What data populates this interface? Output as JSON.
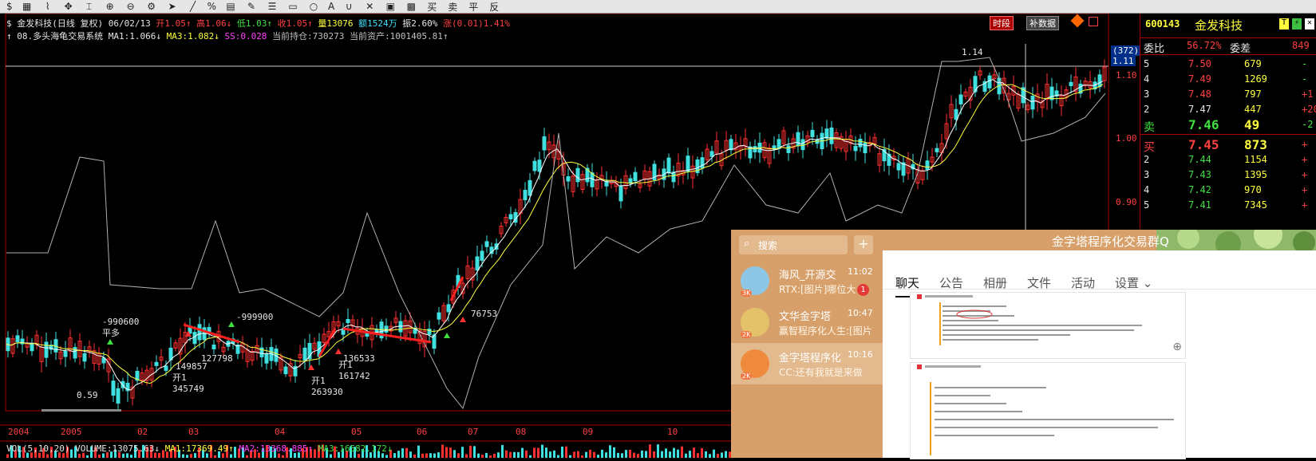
{
  "toolbar": {
    "items": [
      "$",
      "%",
      "A"
    ]
  },
  "chart_header": {
    "line1": [
      {
        "text": "$ 金发科技(日线 复权) 06/02/13",
        "color": "#e6e6e6"
      },
      {
        "text": "开1.05↑",
        "color": "#ff4040"
      },
      {
        "text": "高1.06↓",
        "color": "#ff4040"
      },
      {
        "text": "低1.03↑",
        "color": "#40e040"
      },
      {
        "text": "收1.05↑",
        "color": "#ff4040"
      },
      {
        "text": "量13076",
        "color": "#ffff40"
      },
      {
        "text": "额1524万",
        "color": "#40e0ff"
      },
      {
        "text": "振2.60%",
        "color": "#e6e6e6"
      },
      {
        "text": "涨(0.01)1.41%",
        "color": "#ff4040"
      }
    ],
    "line2": [
      {
        "text": "↑ 08.多头海龟交易系统 MA1:1.066↓",
        "color": "#e6e6e6"
      },
      {
        "text": "MA3:1.082↓",
        "color": "#ffff40"
      },
      {
        "text": "SS:0.028",
        "color": "#ff40ff"
      },
      {
        "text": "当前持仓:730273 当前资产:1001405.81↑",
        "color": "#c0c0c0"
      }
    ],
    "buttons": [
      "时段",
      "补数据"
    ]
  },
  "price_axis": {
    "labels": [
      "1.10",
      "1.00",
      "0.90"
    ],
    "badge_top": "(372)",
    "badge_price": "1.11"
  },
  "chart_annotations": [
    {
      "text": "1.14",
      "color": "#e6e6e6"
    },
    {
      "text": "0.59",
      "color": "#e6e6e6"
    },
    {
      "text": "-990600",
      "color": "#e6e6e6"
    },
    {
      "text": "平多",
      "color": "#e6e6e6"
    },
    {
      "text": "-999900",
      "color": "#e6e6e6"
    },
    {
      "text": "开1 345749",
      "color": "#e6e6e6"
    },
    {
      "text": "开1 263930",
      "color": "#e6e6e6"
    },
    {
      "text": "开1 161742",
      "color": "#e6e6e6"
    },
    {
      "text": "127798",
      "color": "#e6e6e6"
    },
    {
      "text": "149857",
      "color": "#e6e6e6"
    },
    {
      "text": "136533",
      "color": "#e6e6e6"
    },
    {
      "text": "76753",
      "color": "#e6e6e6"
    }
  ],
  "time_axis": {
    "labels": [
      "2004",
      "2005",
      "02",
      "03",
      "04",
      "05",
      "06",
      "07",
      "08",
      "09",
      "10"
    ]
  },
  "volume_line": [
    {
      "text": "VOL(5,10,20) VOLUME:13075.63↓",
      "color": "#e6e6e6"
    },
    {
      "text": "MA1:17369.49↑",
      "color": "#ffff40"
    },
    {
      "text": "MA2:13368.885↑",
      "color": "#ff40ff"
    },
    {
      "text": "MA3:16582.172↓",
      "color": "#40e040"
    }
  ],
  "quote": {
    "code": "600143",
    "name": "金发科技",
    "wei_bi_label": "委比",
    "wei_bi": "56.72%",
    "wei_cha_label": "委差",
    "wei_cha": "849",
    "sell": [
      {
        "level": "5",
        "price": "7.50",
        "vol": "679",
        "chg": "-"
      },
      {
        "level": "4",
        "price": "7.49",
        "vol": "1269",
        "chg": "-"
      },
      {
        "level": "3",
        "price": "7.48",
        "vol": "797",
        "chg": "+1"
      },
      {
        "level": "2",
        "price": "7.47",
        "vol": "447",
        "chg": "+20"
      },
      {
        "level": "卖",
        "price": "7.46",
        "vol": "49",
        "chg": "-2"
      }
    ],
    "buy": [
      {
        "level": "买",
        "price": "7.45",
        "vol": "873",
        "chg": "+"
      },
      {
        "level": "2",
        "price": "7.44",
        "vol": "1154",
        "chg": "+"
      },
      {
        "level": "3",
        "price": "7.43",
        "vol": "1395",
        "chg": "+"
      },
      {
        "level": "4",
        "price": "7.42",
        "vol": "970",
        "chg": "+"
      },
      {
        "level": "5",
        "price": "7.41",
        "vol": "7345",
        "chg": "+"
      }
    ]
  },
  "chat": {
    "search_placeholder": "搜索",
    "add_label": "+",
    "group_title": "金字塔程序化交易群Q",
    "conversations": [
      {
        "name": "海风_开源交",
        "time": "11:02",
        "preview": "RTX:[图片]哪位大",
        "badge": "1",
        "level": "3K"
      },
      {
        "name": "文华金字塔",
        "time": "10:47",
        "preview": "赢智程序化人生:[图片]",
        "badge": "",
        "level": "2K"
      },
      {
        "name": "金字塔程序化",
        "time": "10:16",
        "preview": "CC:还有我就是来做",
        "badge": "",
        "level": "2K"
      }
    ],
    "tabs": [
      "聊天",
      "公告",
      "相册",
      "文件",
      "活动",
      "设置"
    ]
  }
}
